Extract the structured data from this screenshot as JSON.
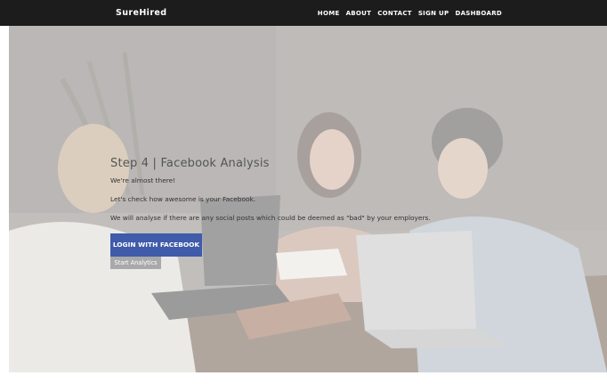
{
  "navbar": {
    "brand": "SureHired",
    "links": [
      "HOME",
      "ABOUT",
      "CONTACT",
      "SIGN UP",
      "DASHBOARD"
    ]
  },
  "hero": {
    "heading": "Step 4 | Facebook Analysis",
    "paragraphs": [
      "We're almost there!",
      "Let's check how awesome is your Facebook.",
      "We will analyse if there are any social posts which could be deemed as \"bad\" by your employers."
    ],
    "login_button_label": "LOGIN WITH FACEBOOK",
    "start_button_label": "Start Analytics"
  },
  "colors": {
    "navbar_bg": "#1c1c1c",
    "facebook_blue": "#3f5ba9",
    "start_button_gray": "#a9a9a9"
  }
}
